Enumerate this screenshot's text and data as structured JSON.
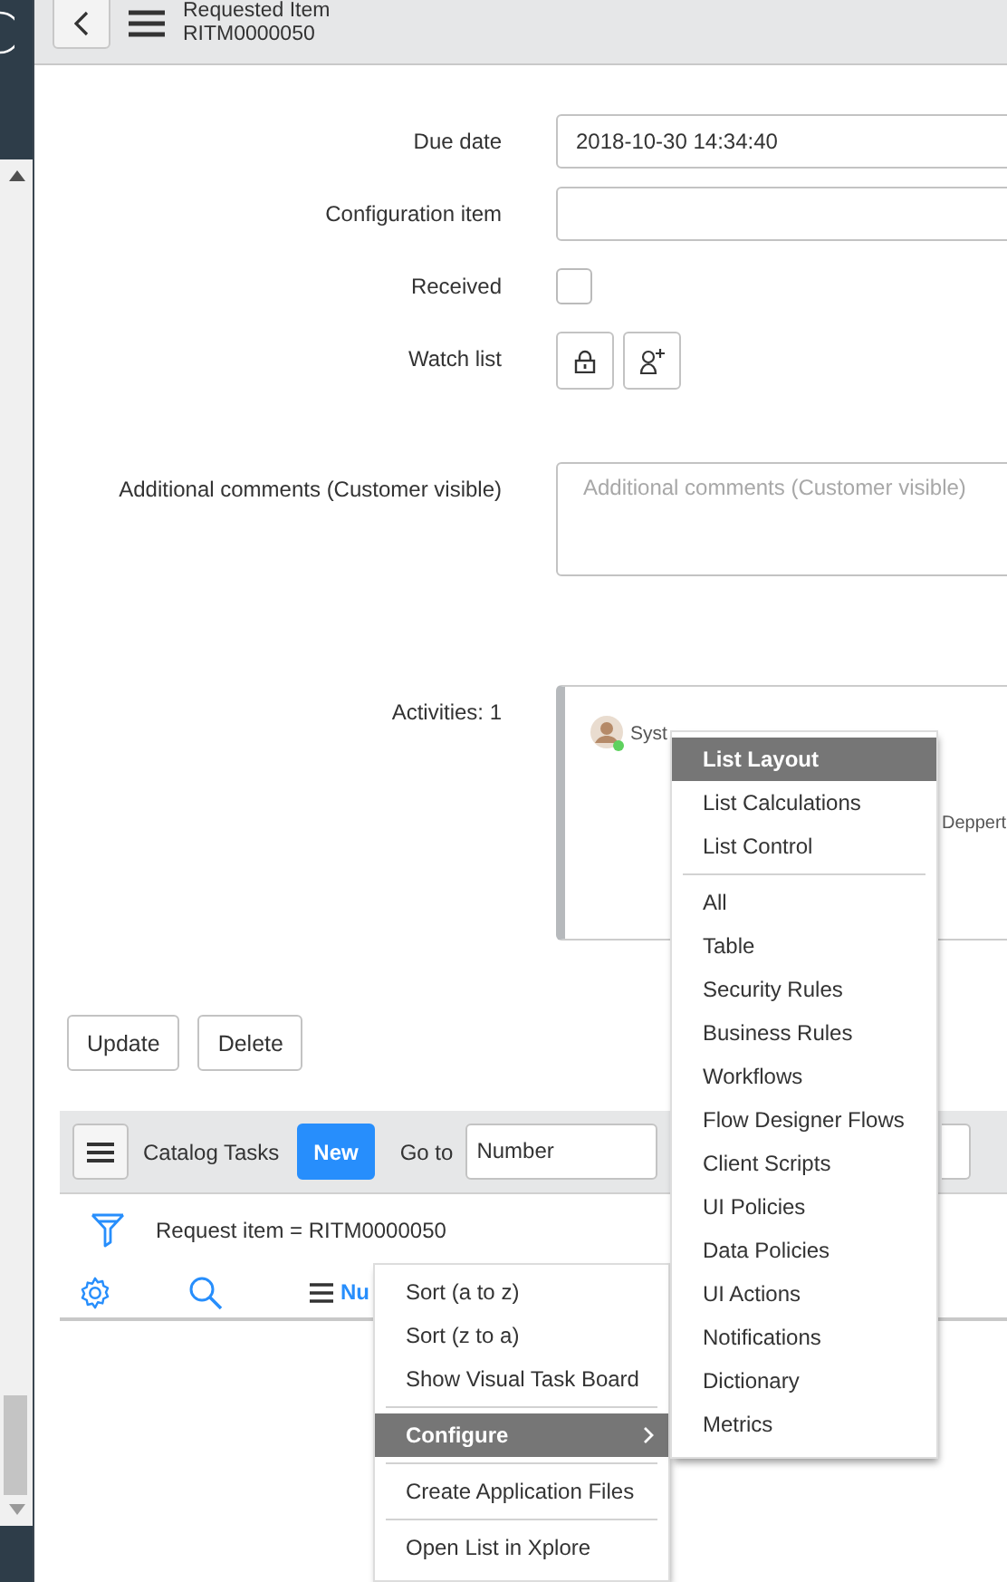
{
  "header": {
    "title": "Requested Item",
    "subtitle": "RITM0000050"
  },
  "form": {
    "fields": [
      {
        "kind": "text",
        "label": "Due date",
        "value": "2018-10-30 14:34:40"
      },
      {
        "kind": "text",
        "label": "Configuration item"
      },
      {
        "kind": "checkbox",
        "label": "Received",
        "checked": false
      },
      {
        "kind": "watchlist",
        "label": "Watch list"
      },
      {
        "kind": "textarea",
        "label": "Additional comments (Customer visible)",
        "placeholder": "Additional comments (Customer visible)"
      }
    ]
  },
  "activities": {
    "label": "Activities: 1",
    "author": "Syst",
    "text": "Deppert"
  },
  "actions": [
    "Update",
    "Delete"
  ],
  "related_list": {
    "title": "Catalog Tasks",
    "new_button": "New",
    "goto_label": "Go to",
    "goto_field": "Number",
    "filter": "Request item = RITM0000050",
    "column_1": "Nu"
  },
  "context_menu": {
    "items": [
      {
        "kind": "item",
        "label": "Sort (a to z)",
        "selected": false
      },
      {
        "kind": "item",
        "label": "Sort (z to a)",
        "selected": false
      },
      {
        "kind": "item",
        "label": "Show Visual Task Board",
        "selected": false
      },
      {
        "kind": "divider"
      },
      {
        "kind": "submenu",
        "label": "Configure",
        "selected": true
      },
      {
        "kind": "divider"
      },
      {
        "kind": "item",
        "label": "Create Application Files",
        "selected": false
      },
      {
        "kind": "divider"
      },
      {
        "kind": "item",
        "label": "Open List in Xplore",
        "selected": false
      }
    ]
  },
  "submenu": {
    "items": [
      {
        "kind": "item",
        "label": "List Layout",
        "selected": true
      },
      {
        "kind": "item",
        "label": "List Calculations",
        "selected": false
      },
      {
        "kind": "item",
        "label": "List Control",
        "selected": false
      },
      {
        "kind": "divider"
      },
      {
        "kind": "item",
        "label": "All",
        "selected": false
      },
      {
        "kind": "item",
        "label": "Table",
        "selected": false
      },
      {
        "kind": "item",
        "label": "Security Rules",
        "selected": false
      },
      {
        "kind": "item",
        "label": "Business Rules",
        "selected": false
      },
      {
        "kind": "item",
        "label": "Workflows",
        "selected": false
      },
      {
        "kind": "item",
        "label": "Flow Designer Flows",
        "selected": false
      },
      {
        "kind": "item",
        "label": "Client Scripts",
        "selected": false
      },
      {
        "kind": "item",
        "label": "UI Policies",
        "selected": false
      },
      {
        "kind": "item",
        "label": "Data Policies",
        "selected": false
      },
      {
        "kind": "item",
        "label": "UI Actions",
        "selected": false
      },
      {
        "kind": "item",
        "label": "Notifications",
        "selected": false
      },
      {
        "kind": "item",
        "label": "Dictionary",
        "selected": false
      },
      {
        "kind": "item",
        "label": "Metrics",
        "selected": false
      }
    ]
  }
}
